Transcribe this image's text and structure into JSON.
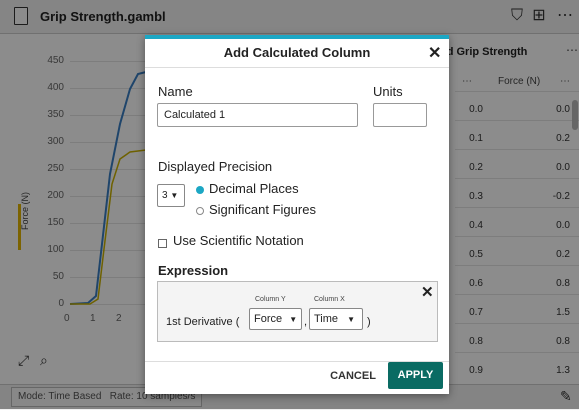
{
  "app": {
    "file_title": "Grip Strength.gambl",
    "toolbar_icons": [
      "shield-check-icon",
      "layout-grid-icon",
      "more-icon"
    ]
  },
  "chart": {
    "y_ticks": [
      "450",
      "400",
      "350",
      "300",
      "250",
      "200",
      "150",
      "100",
      "50",
      "0"
    ],
    "x_ticks": [
      "0",
      "1",
      "2"
    ],
    "ylabel": "Force (N)",
    "colors": {
      "blue": "#3a7fc4",
      "yellow": "#c9b100"
    }
  },
  "table": {
    "title": "nd Grip Strength",
    "col_b_header": "Force (N)",
    "col_a_values": [
      "0.0",
      "0.1",
      "0.2",
      "0.3",
      "0.4",
      "0.5",
      "0.6",
      "0.7",
      "0.8",
      "0.9"
    ],
    "col_b_values": [
      "0.0",
      "0.2",
      "0.0",
      "-0.2",
      "0.0",
      "0.2",
      "0.8",
      "1.5",
      "0.8",
      "1.3"
    ]
  },
  "status": {
    "mode": "Mode: Time Based",
    "rate": "Rate: 10 samples/s"
  },
  "dialog": {
    "title": "Add Calculated Column",
    "name_label": "Name",
    "name_value": "Calculated 1",
    "units_label": "Units",
    "units_value": "",
    "precision_label": "Displayed Precision",
    "precision_value": "3",
    "radio_decimal": "Decimal Places",
    "radio_significant": "Significant Figures",
    "sci_notation": "Use Scientific Notation",
    "expression_label": "Expression",
    "expr_func": "1st Derivative (",
    "expr_comma": ",",
    "expr_close": ")",
    "col_y_label": "Column Y",
    "col_y_value": "Force",
    "col_x_label": "Column X",
    "col_x_value": "Time",
    "cancel_label": "CANCEL",
    "apply_label": "APPLY",
    "accent_color": "#1ca7c4",
    "apply_color": "#0a6b63"
  }
}
